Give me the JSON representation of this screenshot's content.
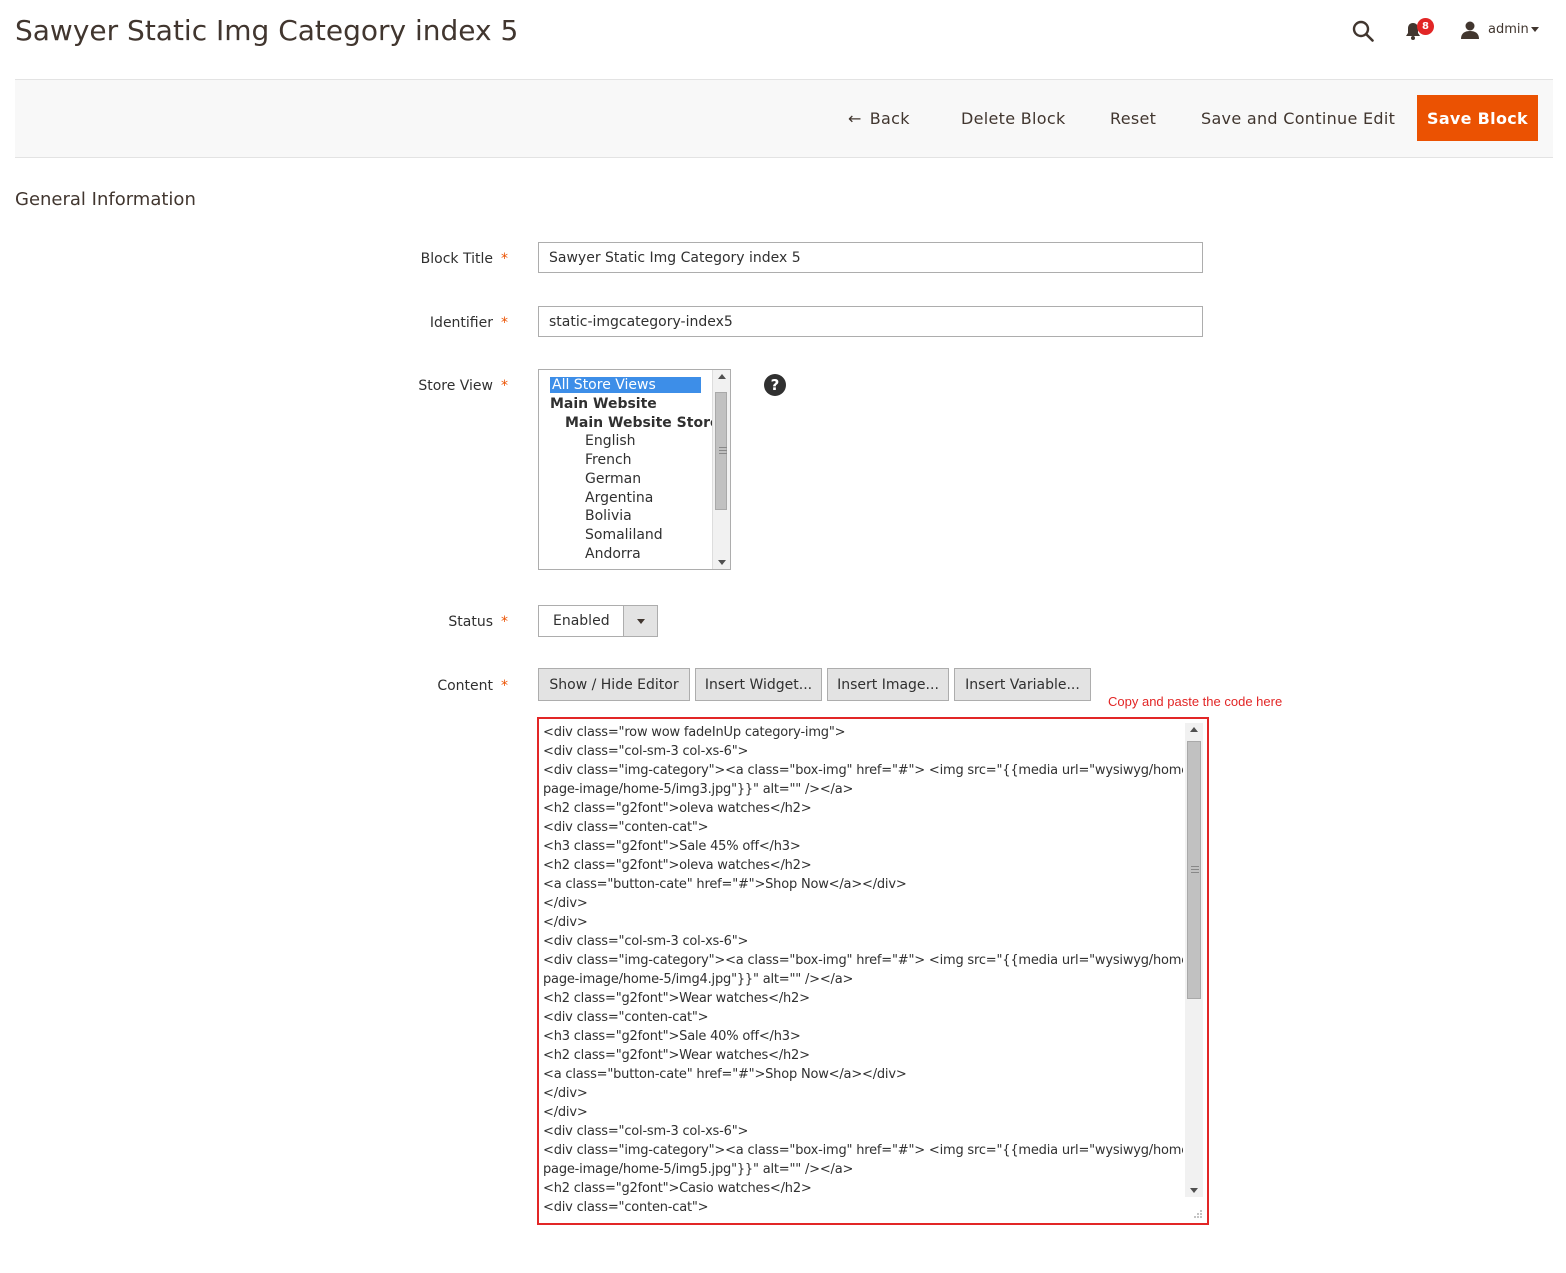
{
  "header": {
    "title": "Sawyer Static Img Category index 5",
    "notification_count": "8",
    "user_name": "admin",
    "icons": [
      "search-icon",
      "bell-icon",
      "user-icon",
      "chevron-down-icon"
    ]
  },
  "actions": {
    "back": "Back",
    "delete": "Delete Block",
    "reset": "Reset",
    "save_continue": "Save and Continue Edit",
    "save": "Save Block"
  },
  "section": {
    "title": "General Information"
  },
  "form": {
    "block_title": {
      "label": "Block Title",
      "value": "Sawyer Static Img Category index 5"
    },
    "identifier": {
      "label": "Identifier",
      "value": "static-imgcategory-index5"
    },
    "store_view": {
      "label": "Store View",
      "options": [
        "All Store Views",
        "Main Website",
        "Main Website Store",
        "English",
        "French",
        "German",
        "Argentina",
        "Bolivia",
        "Somaliland",
        "Andorra"
      ],
      "selected": "All Store Views"
    },
    "status": {
      "label": "Status",
      "value": "Enabled"
    },
    "content": {
      "label": "Content",
      "buttons": [
        "Show / Hide Editor",
        "Insert Widget...",
        "Insert Image...",
        "Insert Variable..."
      ],
      "note": "Copy and paste the code here",
      "lines": [
        "<div class=\"row wow fadeInUp category-img\">",
        "<div class=\"col-sm-3 col-xs-6\">",
        "<div class=\"img-category\"><a class=\"box-img\" href=\"#\"> <img src=\"{{media url=\"wysiwyg/home-",
        "page-image/home-5/img3.jpg\"}}\" alt=\"\" /></a>",
        "<h2 class=\"g2font\">oleva watches</h2>",
        "<div class=\"conten-cat\">",
        "<h3 class=\"g2font\">Sale 45% off</h3>",
        "<h2 class=\"g2font\">oleva watches</h2>",
        "<a class=\"button-cate\" href=\"#\">Shop Now</a></div>",
        "</div>",
        "</div>",
        "<div class=\"col-sm-3 col-xs-6\">",
        "<div class=\"img-category\"><a class=\"box-img\" href=\"#\"> <img src=\"{{media url=\"wysiwyg/home-",
        "page-image/home-5/img4.jpg\"}}\" alt=\"\" /></a>",
        "<h2 class=\"g2font\">Wear watches</h2>",
        "<div class=\"conten-cat\">",
        "<h3 class=\"g2font\">Sale 40% off</h3>",
        "<h2 class=\"g2font\">Wear watches</h2>",
        "<a class=\"button-cate\" href=\"#\">Shop Now</a></div>",
        "</div>",
        "</div>",
        "<div class=\"col-sm-3 col-xs-6\">",
        "<div class=\"img-category\"><a class=\"box-img\" href=\"#\"> <img src=\"{{media url=\"wysiwyg/home-",
        "page-image/home-5/img5.jpg\"}}\" alt=\"\" /></a>",
        "<h2 class=\"g2font\">Casio watches</h2>",
        "<div class=\"conten-cat\">"
      ]
    }
  },
  "colors": {
    "accent": "#eb5202",
    "highlight": "#e22626",
    "selection": "#3d8ee8"
  }
}
